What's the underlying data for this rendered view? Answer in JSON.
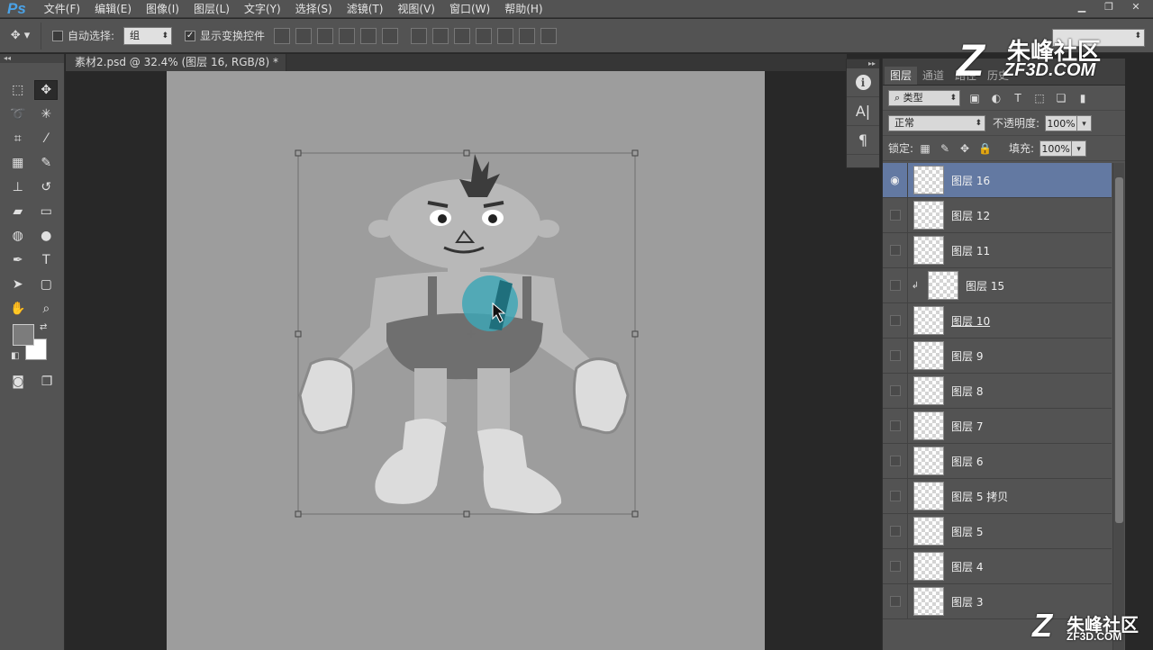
{
  "app": {
    "logo": "Ps"
  },
  "menu": [
    "文件(F)",
    "编辑(E)",
    "图像(I)",
    "图层(L)",
    "文字(Y)",
    "选择(S)",
    "滤镜(T)",
    "视图(V)",
    "窗口(W)",
    "帮助(H)"
  ],
  "window_controls": {
    "minimize": "▁",
    "restore": "❐",
    "close": "✕"
  },
  "options": {
    "tool_icon": "move-tool-icon",
    "auto_select_label": "自动选择:",
    "auto_select_checked": false,
    "auto_select_value": "组",
    "show_transform_label": "显示变换控件",
    "show_transform_checked": true
  },
  "document": {
    "tab_title": "素材2.psd @ 32.4% (图层 16, RGB/8) *",
    "close": "×"
  },
  "layers_panel": {
    "tabs": [
      "图层",
      "通道",
      "路径",
      "历史"
    ],
    "active_tab": "图层",
    "filter_kind": "类型",
    "blend_mode": "正常",
    "opacity_label": "不透明度:",
    "opacity_value": "100%",
    "lock_label": "锁定:",
    "fill_label": "填充:",
    "fill_value": "100%",
    "layers": [
      {
        "name": "图层 16",
        "visible": true,
        "selected": true,
        "clipped": false
      },
      {
        "name": "图层 12",
        "visible": false,
        "selected": false,
        "clipped": false
      },
      {
        "name": "图层 11",
        "visible": false,
        "selected": false,
        "clipped": false
      },
      {
        "name": "图层 15",
        "visible": false,
        "selected": false,
        "clipped": true
      },
      {
        "name": "图层 10",
        "visible": false,
        "selected": false,
        "clipped": false
      },
      {
        "name": "图层 9",
        "visible": false,
        "selected": false,
        "clipped": false
      },
      {
        "name": "图层 8",
        "visible": false,
        "selected": false,
        "clipped": false
      },
      {
        "name": "图层 7",
        "visible": false,
        "selected": false,
        "clipped": false
      },
      {
        "name": "图层 6",
        "visible": false,
        "selected": false,
        "clipped": false
      },
      {
        "name": "图层 5 拷贝",
        "visible": false,
        "selected": false,
        "clipped": false
      },
      {
        "name": "图层 5",
        "visible": false,
        "selected": false,
        "clipped": false
      },
      {
        "name": "图层 4",
        "visible": false,
        "selected": false,
        "clipped": false
      },
      {
        "name": "图层 3",
        "visible": false,
        "selected": false,
        "clipped": false
      }
    ]
  },
  "icon_column": {
    "character_label": "A|",
    "paragraph_label": "¶",
    "info_label": "i"
  },
  "watermark": {
    "brand": "朱峰社区",
    "url": "ZF3D.COM",
    "mark": "Z"
  },
  "colors": {
    "selected_layer": "#6379a2",
    "canvas": "#9d9d9d",
    "highlight": "#3fa6b5"
  }
}
